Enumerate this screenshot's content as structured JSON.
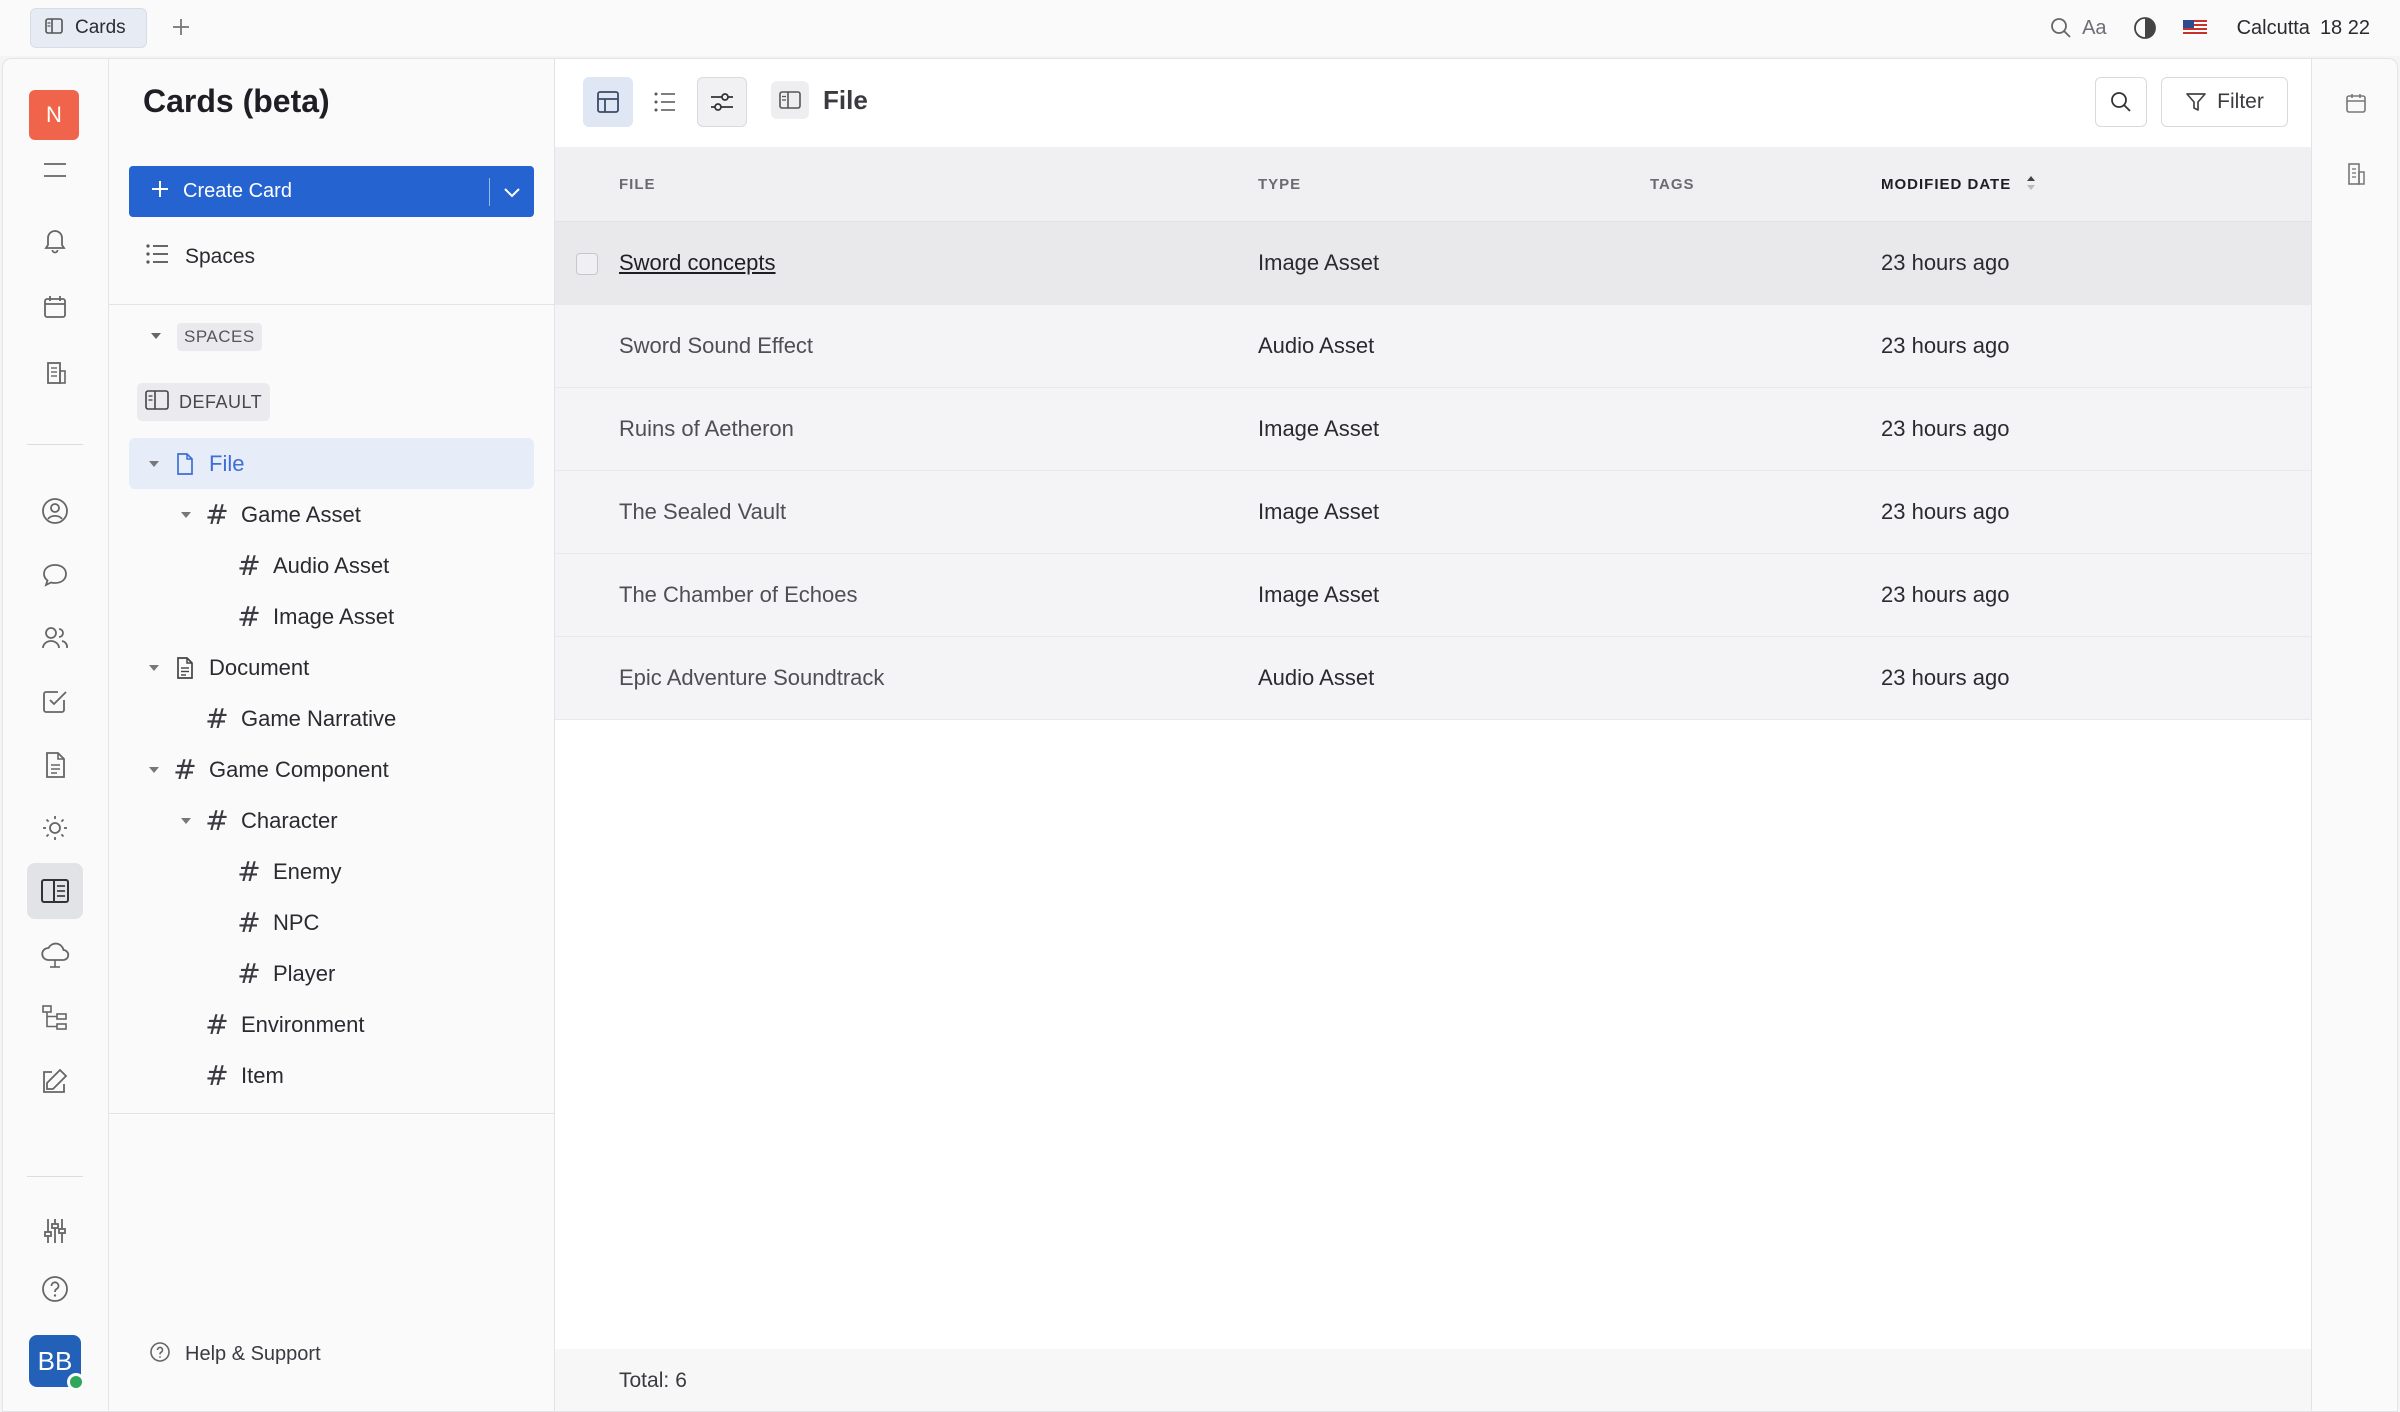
{
  "topbar": {
    "tab_label": "Cards",
    "font_toggle": "Aa",
    "city": "Calcutta",
    "time": "18 22"
  },
  "sidebar": {
    "title": "Cards (beta)",
    "create_label": "Create Card",
    "spaces_link": "Spaces",
    "section_label": "SPACES",
    "default_space": "DEFAULT",
    "tree": [
      {
        "label": "File",
        "kind": "file",
        "level": 0,
        "expanded": true,
        "selected": true
      },
      {
        "label": "Game Asset",
        "kind": "hash",
        "level": 1,
        "expanded": true
      },
      {
        "label": "Audio Asset",
        "kind": "hash",
        "level": 2
      },
      {
        "label": "Image Asset",
        "kind": "hash",
        "level": 2
      },
      {
        "label": "Document",
        "kind": "doc",
        "level": 0,
        "expanded": true
      },
      {
        "label": "Game Narrative",
        "kind": "hash",
        "level": 1
      },
      {
        "label": "Game Component",
        "kind": "hash",
        "level": 0,
        "expanded": true
      },
      {
        "label": "Character",
        "kind": "hash",
        "level": 1,
        "expanded": true
      },
      {
        "label": "Enemy",
        "kind": "hash",
        "level": 2
      },
      {
        "label": "NPC",
        "kind": "hash",
        "level": 2
      },
      {
        "label": "Player",
        "kind": "hash",
        "level": 2
      },
      {
        "label": "Environment",
        "kind": "hash",
        "level": 1
      },
      {
        "label": "Item",
        "kind": "hash",
        "level": 1
      }
    ],
    "help_label": "Help & Support"
  },
  "rail": {
    "workspace_initial": "N",
    "avatar_initials": "BB"
  },
  "main": {
    "breadcrumb": "File",
    "filter_label": "Filter",
    "columns": [
      "FILE",
      "TYPE",
      "TAGS",
      "MODIFIED DATE"
    ],
    "rows": [
      {
        "name": "Sword concepts",
        "type": "Image Asset",
        "tags": "",
        "modified": "23 hours ago"
      },
      {
        "name": "Sword Sound Effect",
        "type": "Audio Asset",
        "tags": "",
        "modified": "23 hours ago"
      },
      {
        "name": "Ruins of Aetheron",
        "type": "Image Asset",
        "tags": "",
        "modified": "23 hours ago"
      },
      {
        "name": "The Sealed Vault",
        "type": "Image Asset",
        "tags": "",
        "modified": "23 hours ago"
      },
      {
        "name": "The Chamber of Echoes",
        "type": "Image Asset",
        "tags": "",
        "modified": "23 hours ago"
      },
      {
        "name": "Epic Adventure Soundtrack",
        "type": "Audio Asset",
        "tags": "",
        "modified": "23 hours ago"
      }
    ],
    "total_label": "Total:",
    "total_count": "6"
  },
  "colors": {
    "accent": "#2563d0",
    "workspace_badge": "#f0644c",
    "avatar": "#2361b8",
    "online": "#2fa65a",
    "selected_tree": "#e6ecf8"
  }
}
